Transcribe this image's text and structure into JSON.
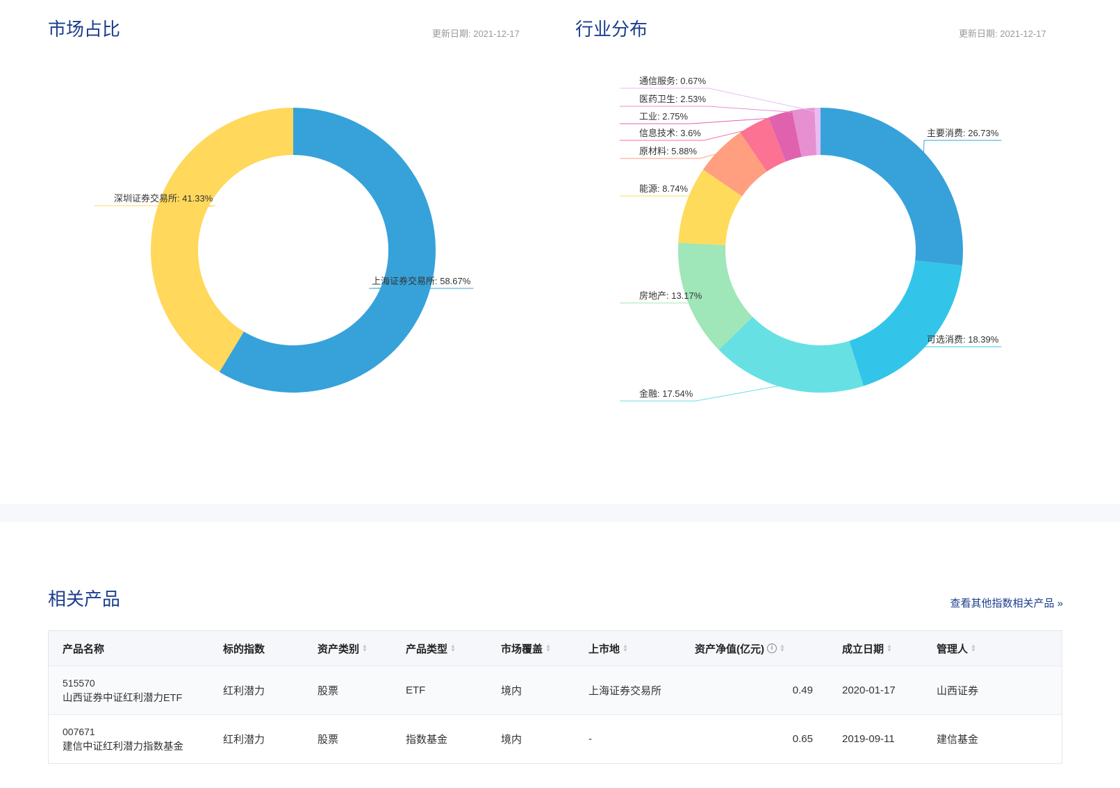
{
  "market": {
    "title": "市场占比",
    "date": "更新日期:  2021-12-17"
  },
  "industry": {
    "title": "行业分布",
    "date": "更新日期:  2021-12-17"
  },
  "chart_data": [
    {
      "type": "pie",
      "title": "市场占比",
      "categories": [
        "上海证券交易所",
        "深圳证券交易所"
      ],
      "values": [
        58.67,
        41.33
      ],
      "labels": [
        "上海证券交易所: 58.67%",
        "深圳证券交易所: 41.33%"
      ],
      "colors": [
        "#37a2da",
        "#ffd85c"
      ]
    },
    {
      "type": "pie",
      "title": "行业分布",
      "categories": [
        "主要消费",
        "可选消费",
        "金融",
        "房地产",
        "能源",
        "原材料",
        "信息技术",
        "工业",
        "医药卫生",
        "通信服务"
      ],
      "values": [
        26.73,
        18.39,
        17.54,
        13.17,
        8.74,
        5.88,
        3.6,
        2.75,
        2.53,
        0.67
      ],
      "labels": [
        "主要消费: 26.73%",
        "可选消费: 18.39%",
        "金融: 17.54%",
        "房地产: 13.17%",
        "能源: 8.74%",
        "原材料: 5.88%",
        "信息技术: 3.6%",
        "工业: 2.75%",
        "医药卫生: 2.53%",
        "通信服务: 0.67%"
      ],
      "colors": [
        "#37a2da",
        "#32c5e9",
        "#67e0e3",
        "#9fe6b8",
        "#ffdb5c",
        "#ff9f7f",
        "#fb7293",
        "#e062ae",
        "#e690d1",
        "#e7bcf3"
      ]
    }
  ],
  "products": {
    "title": "相关产品",
    "more": "查看其他指数相关产品 »",
    "headers": [
      "产品名称",
      "标的指数",
      "资产类别",
      "产品类型",
      "市场覆盖",
      "上市地",
      "资产净值(亿元)",
      "成立日期",
      "管理人"
    ],
    "info_icon": "i",
    "rows": [
      {
        "code": "515570",
        "name": "山西证券中证红利潜力ETF",
        "index": "红利潜力",
        "asset": "股票",
        "type": "ETF",
        "market": "境内",
        "venue": "上海证券交易所",
        "nav": "0.49",
        "date": "2020-01-17",
        "manager": "山西证券"
      },
      {
        "code": "007671",
        "name": "建信中证红利潜力指数基金",
        "index": "红利潜力",
        "asset": "股票",
        "type": "指数基金",
        "market": "境内",
        "venue": "-",
        "nav": "0.65",
        "date": "2019-09-11",
        "manager": "建信基金"
      }
    ]
  }
}
